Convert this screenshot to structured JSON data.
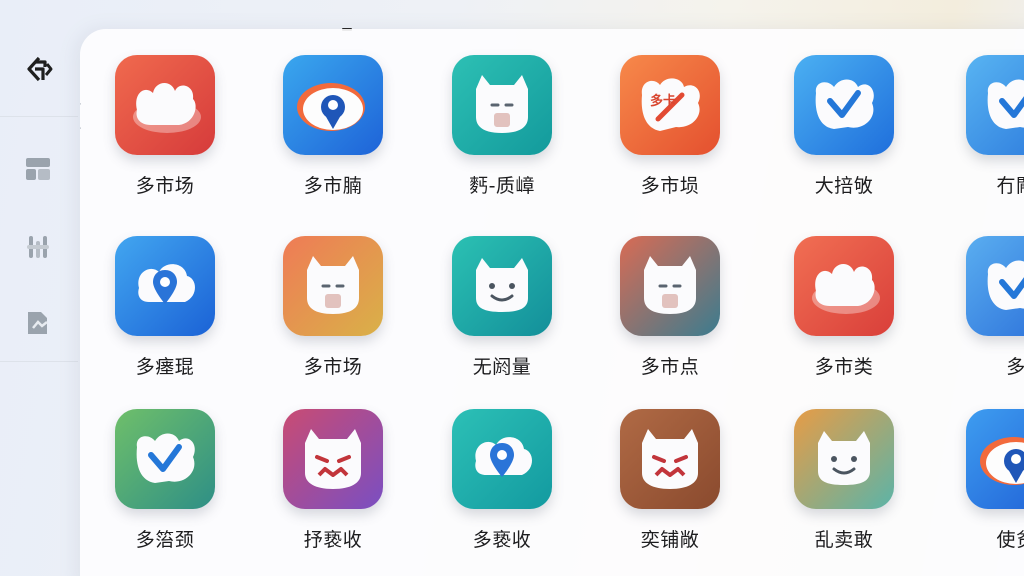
{
  "sidebar": {
    "items": [
      {
        "icon": "logo-icon"
      },
      {
        "icon": "dashboard-icon"
      },
      {
        "icon": "tools-icon"
      },
      {
        "icon": "document-icon"
      }
    ]
  },
  "apps": [
    {
      "label": "多市场",
      "icon": "cat-cloud-icon",
      "gradient": [
        "#f06a4e",
        "#d63b3b"
      ]
    },
    {
      "label": "多市腩",
      "icon": "eye-pin-icon",
      "gradient": [
        "#3aa7ee",
        "#1e63d8"
      ]
    },
    {
      "label": "麫-质嶂",
      "icon": "cat-face-icon",
      "gradient": [
        "#2dc0b4",
        "#139a9c"
      ]
    },
    {
      "label": "多市埙",
      "icon": "tagged-cat-icon",
      "gradient": [
        "#f7894a",
        "#e4502f"
      ]
    },
    {
      "label": "大掊敂",
      "icon": "cat-check-icon",
      "gradient": [
        "#4bb0f2",
        "#1f6fdc"
      ]
    },
    {
      "label": "冇闁",
      "icon": "cat-check-icon",
      "gradient": [
        "#58b4f2",
        "#2b78dc"
      ]
    },
    {
      "label": "多瘗琨",
      "icon": "pin-cloud-icon",
      "gradient": [
        "#42a6f0",
        "#1b62d6"
      ]
    },
    {
      "label": "多市场",
      "icon": "cat-face-icon",
      "gradient": [
        "#ef7b56",
        "#d9b148"
      ]
    },
    {
      "label": "无阏量",
      "icon": "cat-smile-icon",
      "gradient": [
        "#2bc1b3",
        "#138f9a"
      ]
    },
    {
      "label": "多市点",
      "icon": "cat-face-icon",
      "gradient": [
        "#d96b54",
        "#3b7c8f"
      ]
    },
    {
      "label": "多市类",
      "icon": "cat-cloud-icon",
      "gradient": [
        "#f16f53",
        "#d93f3a"
      ]
    },
    {
      "label": "多",
      "icon": "cat-check-icon",
      "gradient": [
        "#5aaef0",
        "#2a6ed9"
      ]
    },
    {
      "label": "多箈颈",
      "icon": "cat-check-icon",
      "gradient": [
        "#6fbf6a",
        "#2e8f86"
      ]
    },
    {
      "label": "抒亵收",
      "icon": "cat-angry-icon",
      "gradient": [
        "#c94b73",
        "#7a4fc2"
      ]
    },
    {
      "label": "多亵收",
      "icon": "pin-cloud-icon",
      "gradient": [
        "#2cc0b6",
        "#139aa0"
      ]
    },
    {
      "label": "奕铺敞",
      "icon": "cat-angry-icon",
      "gradient": [
        "#b06a45",
        "#8a4a2e"
      ]
    },
    {
      "label": "乱卖敢",
      "icon": "cat-smile-icon",
      "gradient": [
        "#e79c46",
        "#5bb4a8"
      ]
    },
    {
      "label": "使贫",
      "icon": "eye-pin-icon",
      "gradient": [
        "#3e9df0",
        "#1f5fd6"
      ]
    }
  ]
}
